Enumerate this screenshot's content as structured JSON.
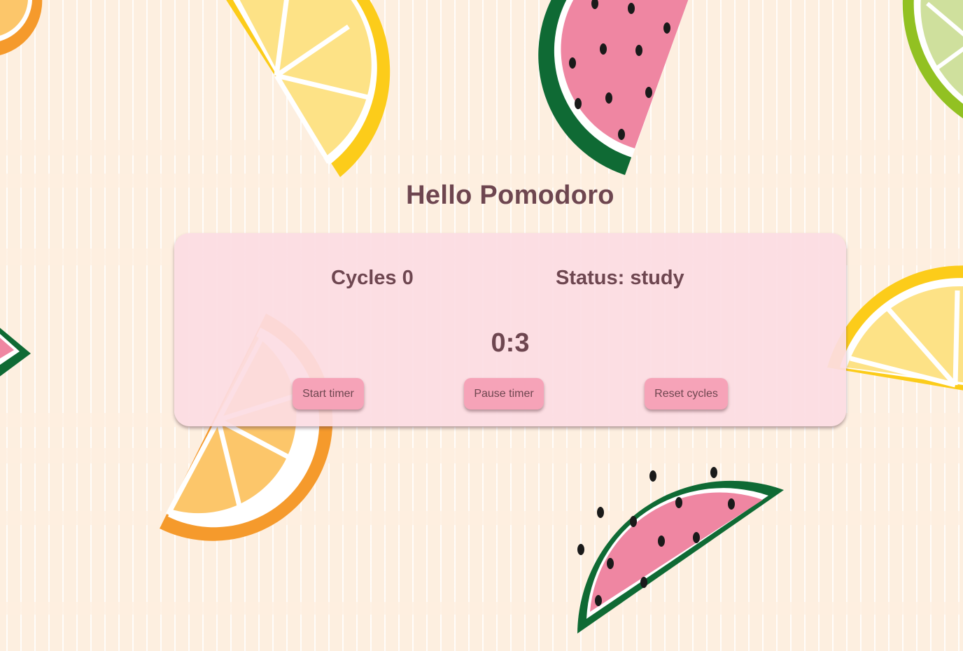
{
  "page": {
    "title": "Hello Pomodoro"
  },
  "stats": {
    "cycles_label": "Cycles 0",
    "status_label": "Status: study"
  },
  "timer": {
    "display": "0:3"
  },
  "controls": {
    "start_label": "Start timer",
    "pause_label": "Pause timer",
    "reset_label": "Reset cycles"
  },
  "theme": {
    "background": "#fdefe0",
    "card": "#fcdde3",
    "text": "#6e4650",
    "button": "#f6a3b8"
  },
  "decorations": [
    "orange-slice-icon",
    "lemon-slice-icon",
    "watermelon-slice-icon",
    "lime-slice-icon"
  ]
}
